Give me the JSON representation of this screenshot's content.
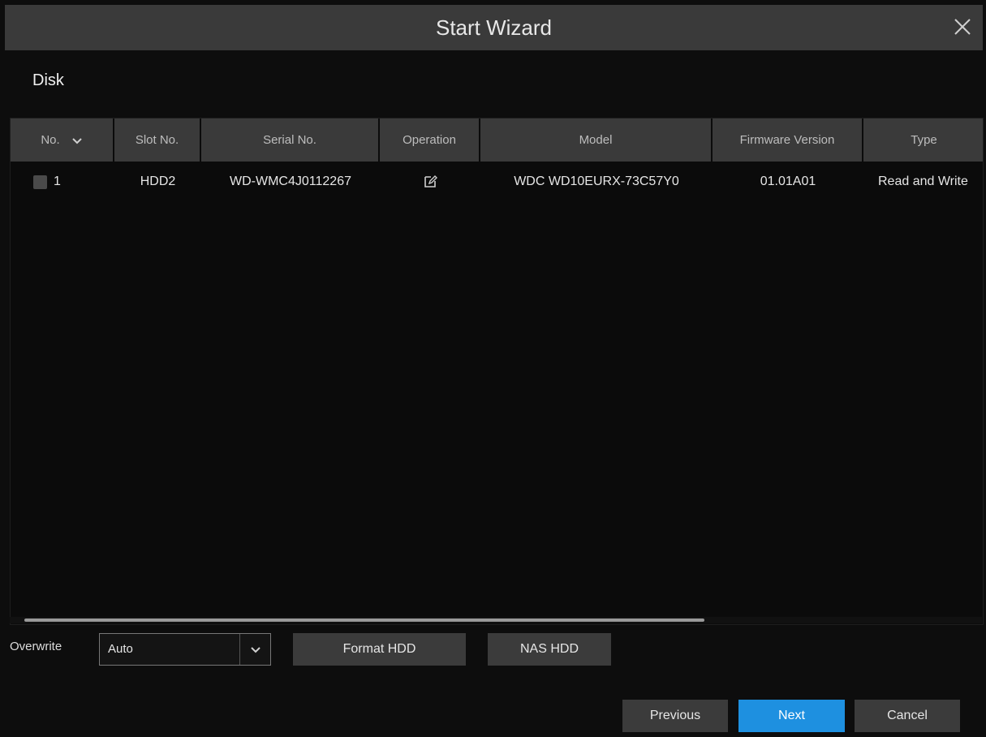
{
  "window": {
    "title": "Start Wizard",
    "close_icon": "close-icon"
  },
  "section_title": "Disk",
  "table": {
    "columns": [
      "No.",
      "Slot No.",
      "Serial No.",
      "Operation",
      "Model",
      "Firmware Version",
      "Type"
    ],
    "rows": [
      {
        "no": "1",
        "slot": "HDD2",
        "serial": "WD-WMC4J0112267",
        "operation_icon": "edit-icon",
        "model": "WDC WD10EURX-73C57Y0",
        "firmware": "01.01A01",
        "type": "Read and Write"
      }
    ]
  },
  "overwrite": {
    "label": "Overwrite",
    "value": "Auto"
  },
  "buttons": {
    "format_hdd": "Format HDD",
    "nas_hdd": "NAS HDD",
    "previous": "Previous",
    "next": "Next",
    "cancel": "Cancel"
  },
  "colors": {
    "background": "#0d0d0d",
    "header": "#3a3a3a",
    "accent": "#1e90e0"
  }
}
